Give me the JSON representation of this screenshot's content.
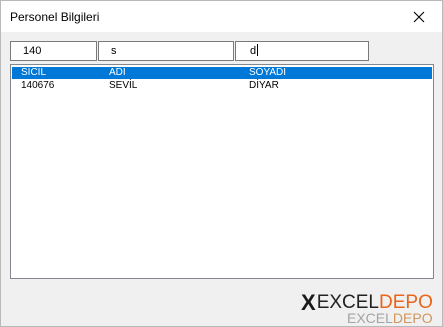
{
  "window": {
    "title": "Personel Bilgileri"
  },
  "filters": {
    "sicil_value": "140",
    "adi_value": "s",
    "soyadi_value": "d"
  },
  "list": {
    "columns": [
      "SİCİL",
      "ADI",
      "SOYADI"
    ],
    "rows": [
      {
        "sicil": "140676",
        "adi": "SEVİL",
        "soyadi": "DİYAR"
      }
    ]
  },
  "watermark": {
    "x": "X",
    "excel": "EXCEL",
    "depo": "DEPO",
    "shadow_excel": "EXCEL",
    "shadow_depo": "DEPO"
  },
  "colors": {
    "header_bg": "#0078d7",
    "logo_accent": "#e8651a"
  }
}
